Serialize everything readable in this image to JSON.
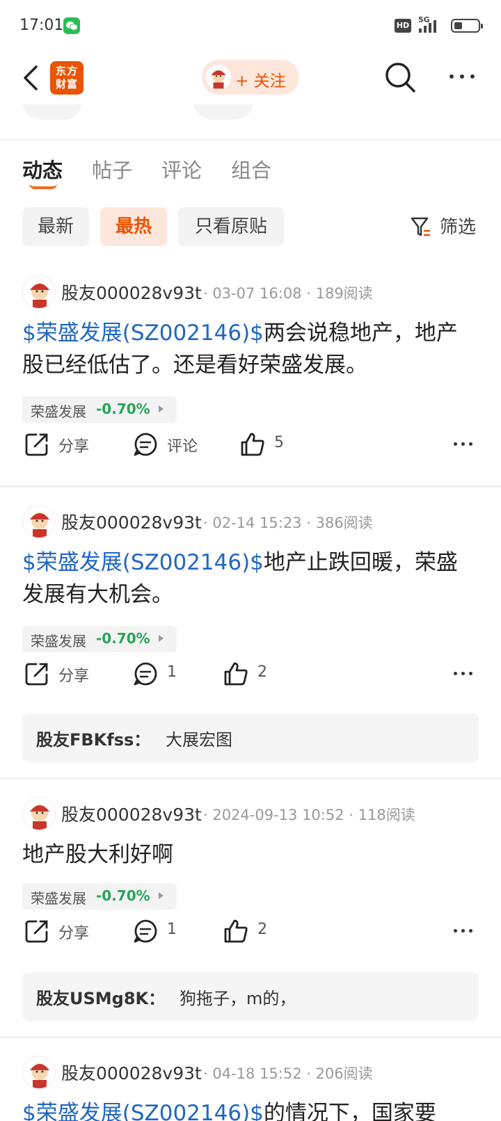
{
  "status_bar": {
    "time": "17:01",
    "hd": "HD",
    "network": "5G"
  },
  "nav": {
    "logo_line1": "东方",
    "logo_line2": "财富",
    "follow_label": "+ 关注"
  },
  "tabs": [
    {
      "label": "动态",
      "active": true
    },
    {
      "label": "帖子",
      "active": false
    },
    {
      "label": "评论",
      "active": false
    },
    {
      "label": "组合",
      "active": false
    }
  ],
  "filters": {
    "chips": [
      {
        "label": "最新",
        "active": false
      },
      {
        "label": "最热",
        "active": true
      },
      {
        "label": "只看原贴",
        "active": false
      }
    ],
    "filter_label": "筛选"
  },
  "posts": [
    {
      "author": "股友000028v93t",
      "meta": "· 03-07 16:08 · 189阅读",
      "stock_link": "$荣盛发展(SZ002146)$",
      "text": "两会说稳地产，地产股已经低估了。还是看好荣盛发展。",
      "tag_name": "荣盛发展",
      "tag_change": "-0.70%",
      "share": "分享",
      "comment": "评论",
      "likes": "5"
    },
    {
      "author": "股友000028v93t",
      "meta": "· 02-14 15:23 · 386阅读",
      "stock_link": "$荣盛发展(SZ002146)$",
      "text": "地产止跌回暖，荣盛发展有大机会。",
      "tag_name": "荣盛发展",
      "tag_change": "-0.70%",
      "share": "分享",
      "comment": "1",
      "likes": "2",
      "reply_user": "股友FBKfss：",
      "reply_text": "大展宏图"
    },
    {
      "author": "股友000028v93t",
      "meta": "· 2024-09-13 10:52 · 118阅读",
      "stock_link": "",
      "text": "地产股大利好啊",
      "tag_name": "荣盛发展",
      "tag_change": "-0.70%",
      "share": "分享",
      "comment": "1",
      "likes": "2",
      "reply_user": "股友USMg8K：",
      "reply_text": "狗拖子，m的，"
    },
    {
      "author": "股友000028v93t",
      "meta": "· 04-18 15:52 · 206阅读",
      "stock_link": "$荣盛发展(SZ002146)$",
      "text": "的情况下，国家要"
    }
  ],
  "colors": {
    "accent": "#ea5404",
    "stock_link": "#1f66c1",
    "down": "#29a35a"
  }
}
